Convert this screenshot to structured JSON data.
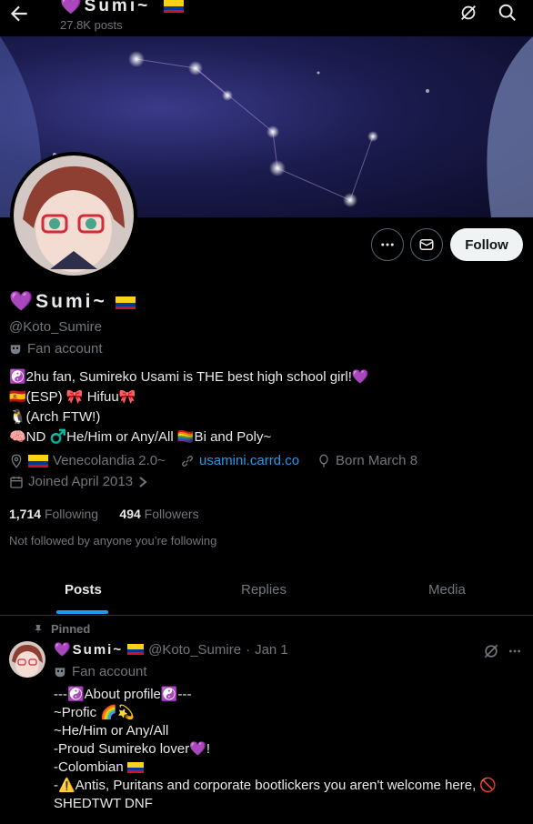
{
  "header": {
    "display_name": "💜Sumi~",
    "posts_count": "27.8K posts",
    "back_label": "Back"
  },
  "profile": {
    "display_name": "💜Sumi~",
    "handle": "@Koto_Sumire",
    "label": "Fan account",
    "follow_label": "Follow",
    "bio_lines": [
      "☯️2hu fan, Sumireko Usami is THE best high school girl!💜",
      "🇪🇸(ESP) 🎀 Hifuu🎀",
      "🐧(Arch FTW!)",
      "🧠ND ♂️He/Him or Any/All 🏳️‍🌈Bi and Poly~"
    ],
    "location": "Venecolandia 2.0~",
    "website": "usamini.carrd.co",
    "birthday": "Born March 8",
    "joined": "Joined April 2013",
    "following_count": "1,714",
    "following_label": "Following",
    "followers_count": "494",
    "followers_label": "Followers",
    "not_followed_text": "Not followed by anyone you’re following"
  },
  "tabs": [
    {
      "label": "Posts",
      "active": true
    },
    {
      "label": "Replies",
      "active": false
    },
    {
      "label": "Media",
      "active": false
    }
  ],
  "pinned_tweet": {
    "pinned_label": "Pinned",
    "display_name": "💜Sumi~",
    "handle": "@Koto_Sumire",
    "date": "Jan 1",
    "separator": "·",
    "label": "Fan account",
    "lines": [
      "---☯️About profile☯️---",
      "~Profic 🌈💫",
      "~He/Him or Any/All",
      "-Proud Sumireko lover💜!",
      "-Colombian",
      "-⚠️Antis, Puritans and corporate bootlickers you aren't welcome here, 🚫",
      "SHEDTWT DNF"
    ]
  },
  "colors": {
    "background": "#000000",
    "text": "#e7e9ea",
    "muted": "#71767b",
    "link": "#1d9bf0",
    "follow_button_bg": "#eff3f4",
    "border": "#2f3336"
  },
  "icons": [
    "back-arrow-icon",
    "grok-icon",
    "search-icon",
    "more-icon",
    "message-icon",
    "mask-icon",
    "location-icon",
    "link-icon",
    "balloon-icon",
    "calendar-icon",
    "pin-icon"
  ]
}
